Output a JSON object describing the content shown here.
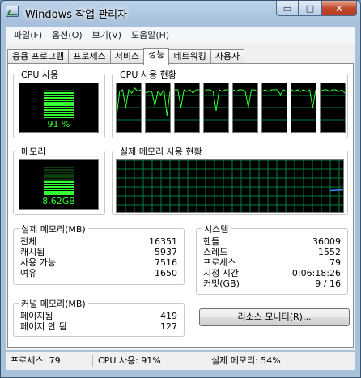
{
  "window": {
    "title": "Windows 작업 관리자"
  },
  "caption": {
    "minimize": "▭",
    "maximize": "□",
    "close": "✕"
  },
  "menu": [
    "파일(F)",
    "옵션(O)",
    "보기(V)",
    "도움말(H)"
  ],
  "tabs": [
    "응용 프로그램",
    "프로세스",
    "서비스",
    "성능",
    "네트워킹",
    "사용자"
  ],
  "active_tab": "성능",
  "cpu_usage": {
    "label": "CPU 사용",
    "value_text": "91 %",
    "percent": 91
  },
  "cpu_history": {
    "label": "CPU 사용 현황",
    "cores": 8
  },
  "memory": {
    "label": "메모리",
    "value_text": "8.62GB",
    "percent": 54
  },
  "memory_history": {
    "label": "실제 메모리 사용 현황"
  },
  "physical_memory": {
    "label": "실제 메모리(MB)",
    "rows": [
      {
        "k": "전체",
        "v": "16351"
      },
      {
        "k": "캐시됨",
        "v": "5937"
      },
      {
        "k": "사용 가능",
        "v": "7516"
      },
      {
        "k": "여유",
        "v": "1650"
      }
    ]
  },
  "system": {
    "label": "시스템",
    "rows": [
      {
        "k": "핸들",
        "v": "36009"
      },
      {
        "k": "스레드",
        "v": "1552"
      },
      {
        "k": "프로세스",
        "v": "79"
      },
      {
        "k": "지정 시간",
        "v": "0:06:18:26"
      },
      {
        "k": "커밋(GB)",
        "v": "9 / 16"
      }
    ]
  },
  "kernel_memory": {
    "label": "커널 메모리(MB)",
    "rows": [
      {
        "k": "페이지됨",
        "v": "419"
      },
      {
        "k": "페이지 안 됨",
        "v": "127"
      }
    ]
  },
  "resource_monitor_button": "리소스 모니터(R)...",
  "status": {
    "processes": "프로세스: 79",
    "cpu": "CPU 사용: 91%",
    "memory": "실제 메모리: 54%"
  },
  "colors": {
    "graph_green": "#33ff33",
    "grid_green": "#008040",
    "memory_line": "#3b8fff"
  }
}
